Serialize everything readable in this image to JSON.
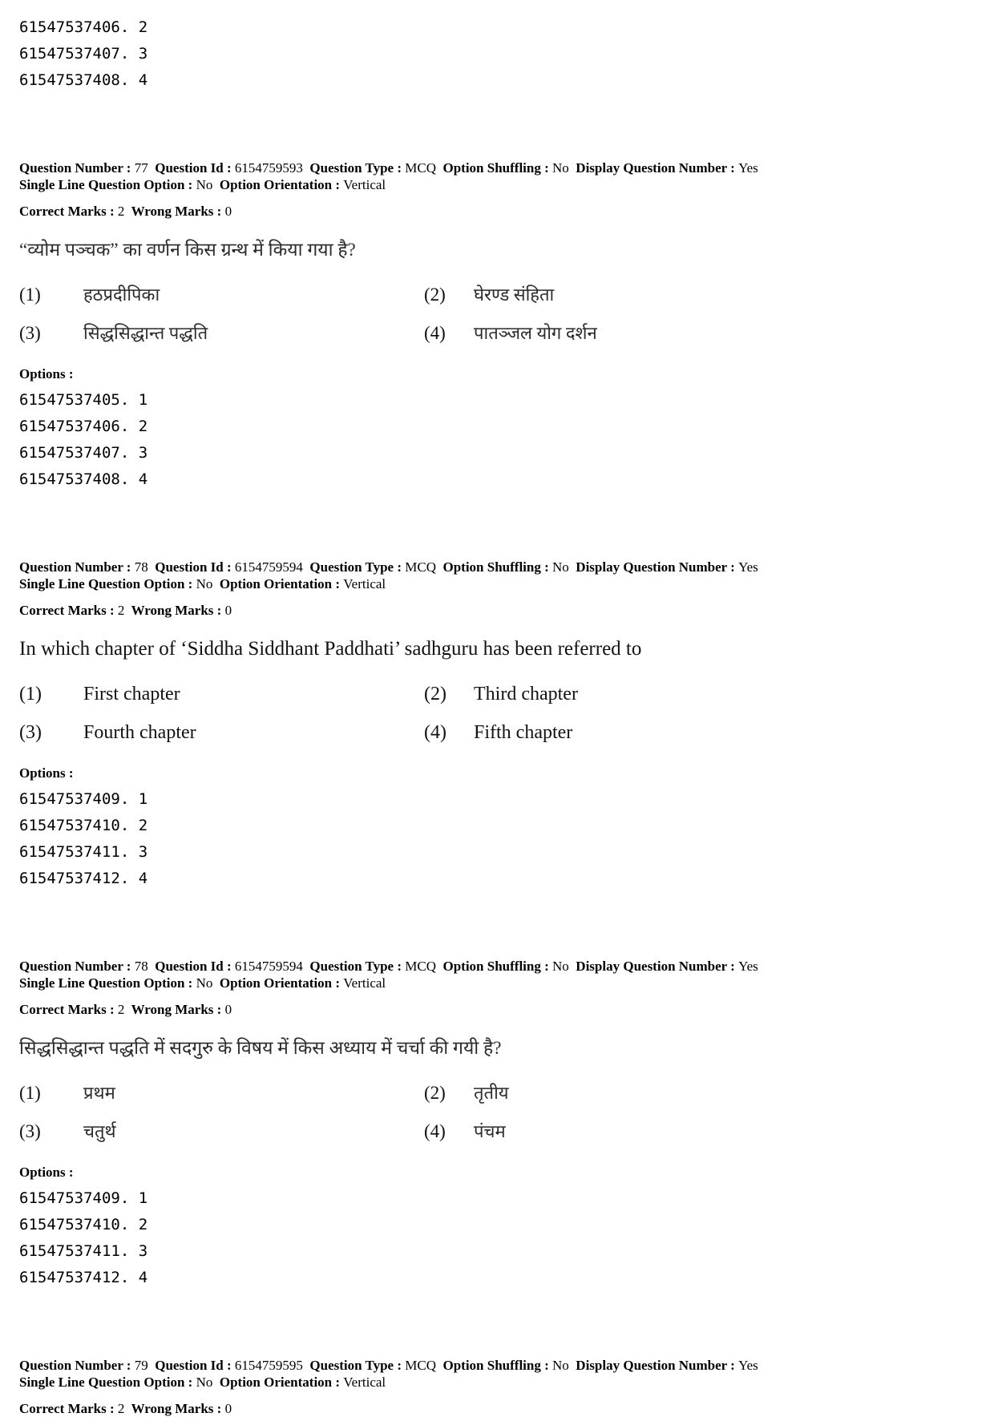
{
  "document": {
    "type": "exam-answer-key",
    "options_label": "Options :"
  },
  "top_option_ids": [
    "61547537406. 2",
    "61547537407. 3",
    "61547537408. 4"
  ],
  "meta_labels": {
    "question_number": "Question Number :",
    "question_id": "Question Id :",
    "question_type": "Question Type :",
    "option_shuffling": "Option Shuffling :",
    "display_question_number": "Display Question Number :",
    "single_line_question_option": "Single Line Question Option :",
    "option_orientation": "Option Orientation :",
    "correct_marks": "Correct Marks :",
    "wrong_marks": "Wrong Marks :"
  },
  "questions": [
    {
      "meta": {
        "question_number": "77",
        "question_id": "6154759593",
        "question_type": "MCQ",
        "option_shuffling": "No",
        "display_question_number": "Yes",
        "single_line_question_option": "No",
        "option_orientation": "Vertical",
        "correct_marks": "2",
        "wrong_marks": "0"
      },
      "language": "hindi",
      "stem": "“व्योम पञ्चक” का वर्णन किस ग्रन्थ में किया गया है?",
      "options": [
        {
          "num": "(1)",
          "text": "हठप्रदीपिका"
        },
        {
          "num": "(2)",
          "text": "घेरण्ड संहिता"
        },
        {
          "num": "(3)",
          "text": "सिद्धसिद्धान्त पद्धति"
        },
        {
          "num": "(4)",
          "text": "पातञ्जल योग दर्शन"
        }
      ],
      "option_ids": [
        "61547537405. 1",
        "61547537406. 2",
        "61547537407. 3",
        "61547537408. 4"
      ]
    },
    {
      "meta": {
        "question_number": "78",
        "question_id": "6154759594",
        "question_type": "MCQ",
        "option_shuffling": "No",
        "display_question_number": "Yes",
        "single_line_question_option": "No",
        "option_orientation": "Vertical",
        "correct_marks": "2",
        "wrong_marks": "0"
      },
      "language": "english",
      "stem": "In which chapter of ‘Siddha Siddhant Paddhati’ sadhguru has been referred to",
      "options": [
        {
          "num": "(1)",
          "text": "First chapter"
        },
        {
          "num": "(2)",
          "text": "Third chapter"
        },
        {
          "num": "(3)",
          "text": "Fourth chapter"
        },
        {
          "num": "(4)",
          "text": "Fifth chapter"
        }
      ],
      "option_ids": [
        "61547537409. 1",
        "61547537410. 2",
        "61547537411. 3",
        "61547537412. 4"
      ]
    },
    {
      "meta": {
        "question_number": "78",
        "question_id": "6154759594",
        "question_type": "MCQ",
        "option_shuffling": "No",
        "display_question_number": "Yes",
        "single_line_question_option": "No",
        "option_orientation": "Vertical",
        "correct_marks": "2",
        "wrong_marks": "0"
      },
      "language": "hindi",
      "stem": "सिद्धसिद्धान्त पद्धति में सदगुरु के विषय में किस अध्याय में चर्चा की गयी है?",
      "options": [
        {
          "num": "(1)",
          "text": "प्रथम"
        },
        {
          "num": "(2)",
          "text": "तृतीय"
        },
        {
          "num": "(3)",
          "text": "चतुर्थ"
        },
        {
          "num": "(4)",
          "text": "पंचम"
        }
      ],
      "option_ids": [
        "61547537409. 1",
        "61547537410. 2",
        "61547537411. 3",
        "61547537412. 4"
      ]
    }
  ],
  "trailing_meta": {
    "question_number": "79",
    "question_id": "6154759595",
    "question_type": "MCQ",
    "option_shuffling": "No",
    "display_question_number": "Yes",
    "single_line_question_option": "No",
    "option_orientation": "Vertical",
    "correct_marks": "2",
    "wrong_marks": "0"
  }
}
